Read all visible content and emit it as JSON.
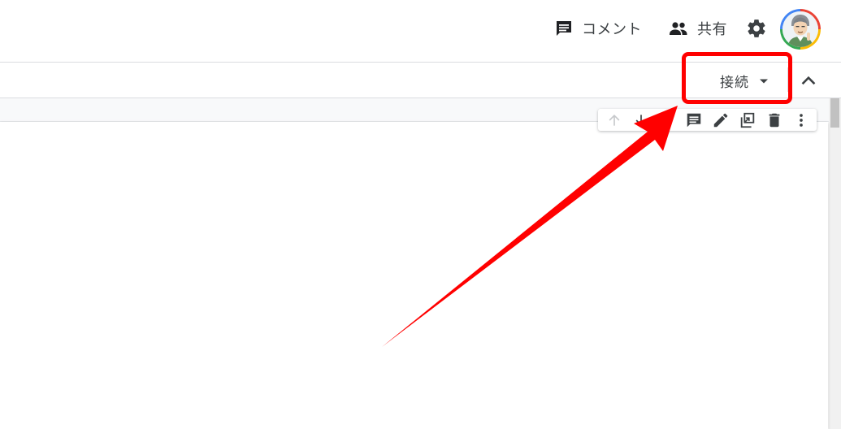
{
  "header": {
    "comment_label": "コメント",
    "share_label": "共有",
    "settings_icon": "gear-icon",
    "avatar_icon": "user-avatar"
  },
  "toolbar": {
    "connect_label": "接続",
    "collapse_icon": "chevron-up-icon"
  },
  "cell_toolbar": {
    "icons": [
      "arrow-up-icon",
      "arrow-down-icon",
      "comment-icon",
      "edit-icon",
      "mirror-cell-icon",
      "delete-icon",
      "more-vert-icon"
    ]
  },
  "colors": {
    "annotation": "#ff0000",
    "icon": "#3c4043",
    "divider": "#dadce0"
  }
}
